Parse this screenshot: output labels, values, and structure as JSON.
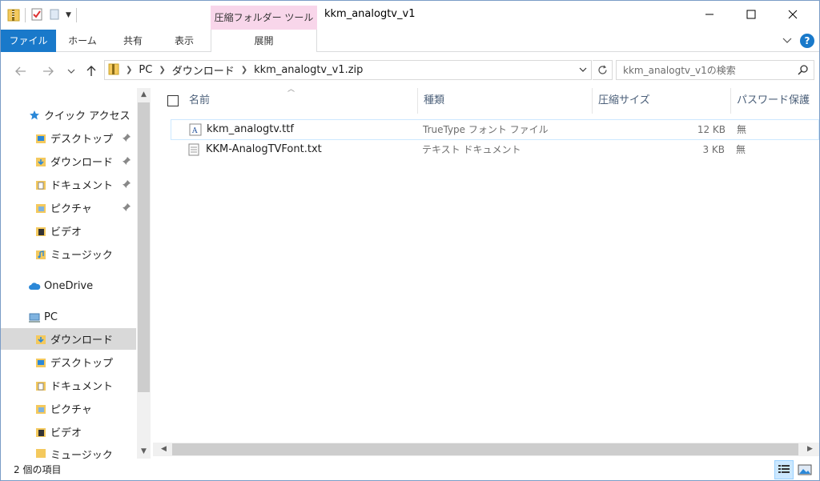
{
  "window": {
    "title": "kkm_analogtv_v1",
    "context_tab_title": "圧縮フォルダー ツール"
  },
  "ribbon": {
    "tabs": [
      "ファイル",
      "ホーム",
      "共有",
      "表示",
      "展開"
    ]
  },
  "address": {
    "crumbs": [
      "PC",
      "ダウンロード",
      "kkm_analogtv_v1.zip"
    ]
  },
  "search": {
    "placeholder": "kkm_analogtv_v1の検索"
  },
  "sidebar": {
    "quick_access": "クイック アクセス",
    "quick_items": [
      "デスクトップ",
      "ダウンロード",
      "ドキュメント",
      "ピクチャ",
      "ビデオ",
      "ミュージック"
    ],
    "onedrive": "OneDrive",
    "pc": "PC",
    "pc_items": [
      "ダウンロード",
      "デスクトップ",
      "ドキュメント",
      "ピクチャ",
      "ビデオ",
      "ミュージック"
    ]
  },
  "columns": [
    "名前",
    "種類",
    "圧縮サイズ",
    "パスワード保護"
  ],
  "files": [
    {
      "name": "kkm_analogtv.ttf",
      "type": "TrueType フォント ファイル",
      "size": "12 KB",
      "password": "無"
    },
    {
      "name": "KKM-AnalogTVFont.txt",
      "type": "テキスト ドキュメント",
      "size": "3 KB",
      "password": "無"
    }
  ],
  "status": {
    "count": "2 個の項目"
  },
  "colors": {
    "accent": "#1979ca",
    "context_tab": "#f8d6ea",
    "selection": "#d9d9d9",
    "hover_border": "#cde8ff"
  }
}
